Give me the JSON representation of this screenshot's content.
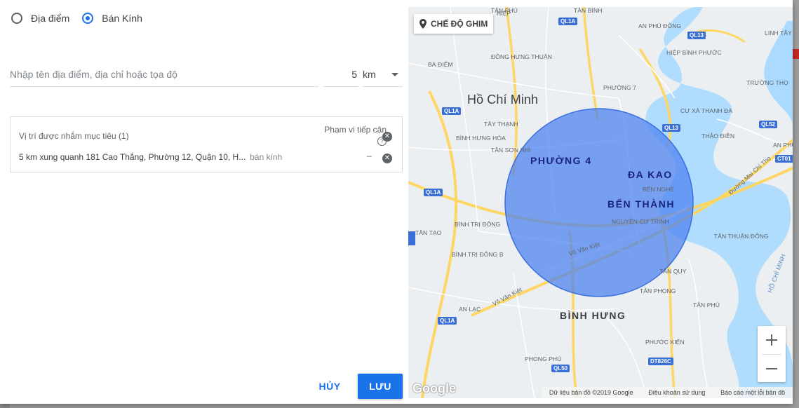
{
  "radio_options": [
    {
      "label": "Địa điểm",
      "checked": false
    },
    {
      "label": "Bán Kính",
      "checked": true
    }
  ],
  "search": {
    "placeholder": "Nhập tên địa điểm, địa chỉ hoặc tọa độ",
    "value": ""
  },
  "radius": {
    "value": "5",
    "unit": "km"
  },
  "targeting": {
    "header": "Vị trí được nhắm mục tiêu (1)",
    "reach_header": "Phạm vi tiếp cận",
    "help_icon": "?",
    "items": [
      {
        "text": "5 km xung quanh 181 Cao Thắng, Phường 12, Quận 10, H...",
        "type": "bán kính",
        "reach": "–"
      }
    ]
  },
  "actions": {
    "cancel": "HỦY",
    "save": "LƯU"
  },
  "map": {
    "pin_mode": "CHẾ ĐỘ GHIM",
    "city": "Hồ Chí Minh",
    "districts": [
      "PHƯỜNG 4",
      "ĐA KAO",
      "BẾN THÀNH",
      "BÌNH HƯNG"
    ],
    "road_labels": [
      "Võ Văn Kiệt",
      "Võ Văn Kiệt",
      "Đường Mai Chí Thọ",
      "HỒ CHÍ MINH"
    ],
    "shields": [
      "QL1A",
      "QL13",
      "QL1A",
      "QL13",
      "QL52",
      "QL1A",
      "CT01",
      "QL1A",
      "QL50",
      "DT826C"
    ],
    "places": [
      "AN PHÚ ĐÔNG",
      "LINH TÂY",
      "HIỆP BÌNH PHƯỚC",
      "BÀ ĐIỂM",
      "ĐÔNG HƯNG THUẬN",
      "PHƯỜNG 7",
      "TRƯỜNG THỌ",
      "CƯ XÁ THANH ĐA",
      "TÂY THẠNH",
      "BÌNH HƯNG HÒA",
      "TÂN SƠN NHÌ",
      "THẢO ĐIỀN",
      "AN PHÚ",
      "BẾN NGHÉ",
      "NGUYỄN CƯ TRINH",
      "BÌNH TRỊ ĐÔNG",
      "TÂN TẠO",
      "BÌNH TRỊ ĐÔNG B",
      "TÂN THUẬN ĐÔNG",
      "TÂN QUY",
      "TÂN PHONG",
      "AN LẠC",
      "TÂN PHÚ",
      "PHƯỚC KIỂN",
      "PHONG PHÚ",
      "HIỆP",
      "TÂN BÌNH",
      "TÂN PHÚ"
    ],
    "google": "Google",
    "attribution": [
      "Dữ liệu bản đồ ©2019 Google",
      "Điều khoản sử dụng",
      "Báo cáo một lỗi bản đồ"
    ],
    "radius_circle_color": "#4a7ff0"
  },
  "colors": {
    "accent": "#1a73e8"
  }
}
